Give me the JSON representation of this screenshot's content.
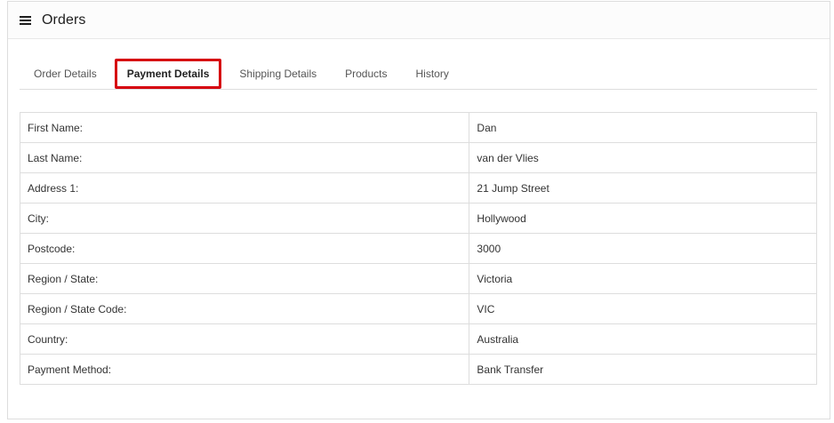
{
  "header": {
    "title": "Orders",
    "icon": "list-icon"
  },
  "tabs": [
    {
      "label": "Order Details",
      "active": false
    },
    {
      "label": "Payment Details",
      "active": true
    },
    {
      "label": "Shipping Details",
      "active": false
    },
    {
      "label": "Products",
      "active": false
    },
    {
      "label": "History",
      "active": false
    }
  ],
  "highlight_color": "#d6000e",
  "payment_details": [
    {
      "label": "First Name:",
      "value": "Dan"
    },
    {
      "label": "Last Name:",
      "value": "van der Vlies"
    },
    {
      "label": "Address 1:",
      "value": "21 Jump Street"
    },
    {
      "label": "City:",
      "value": "Hollywood"
    },
    {
      "label": "Postcode:",
      "value": "3000"
    },
    {
      "label": "Region / State:",
      "value": "Victoria"
    },
    {
      "label": "Region / State Code:",
      "value": "VIC"
    },
    {
      "label": "Country:",
      "value": "Australia"
    },
    {
      "label": "Payment Method:",
      "value": "Bank Transfer"
    }
  ]
}
